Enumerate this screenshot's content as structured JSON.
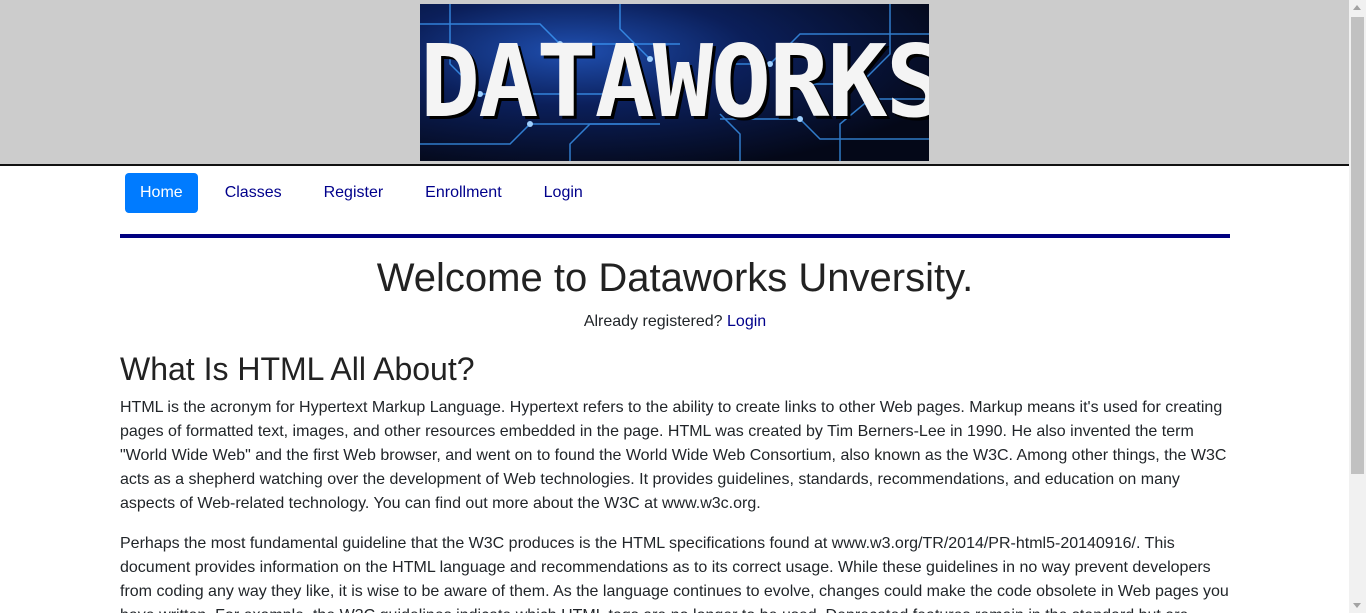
{
  "header": {
    "banner_text": "Dataworks",
    "background_color": "#cccccc"
  },
  "nav": {
    "items": [
      {
        "label": "Home",
        "active": true
      },
      {
        "label": "Classes",
        "active": false
      },
      {
        "label": "Register",
        "active": false
      },
      {
        "label": "Enrollment",
        "active": false
      },
      {
        "label": "Login",
        "active": false
      }
    ],
    "active_color": "#007bff",
    "link_color": "#00008b"
  },
  "main": {
    "welcome_title": "Welcome to Dataworks Unversity.",
    "already_text": "Already registered?",
    "login_link": "Login",
    "heading": "What Is HTML All About?",
    "paragraph1": "HTML is the acronym for Hypertext Markup Language. Hypertext refers to the ability to create links to other Web pages. Markup means it's used for creating pages of formatted text, images, and other resources embedded in the page. HTML was created by Tim Berners-Lee in 1990. He also invented the term \"World Wide Web\" and the first Web browser, and went on to found the World Wide Web Consortium, also known as the W3C. Among other things, the W3C acts as a shepherd watching over the development of Web technologies. It provides guidelines, standards, recommendations, and education on many aspects of Web-related technology. You can find out more about the W3C at www.w3c.org.",
    "paragraph2": "Perhaps the most fundamental guideline that the W3C produces is the HTML specifications found at www.w3.org/TR/2014/PR-html5-20140916/. This document provides information on the HTML language and recommendations as to its correct usage. While these guidelines in no way prevent developers from coding any way they like, it is wise to be aware of them. As the language continues to evolve, changes could make the code obsolete in Web pages you have written. For example, the W3C guidelines indicate which HTML tags are no longer to be used. Deprecated features remain in the standard but are"
  },
  "rule_color": "#000080"
}
